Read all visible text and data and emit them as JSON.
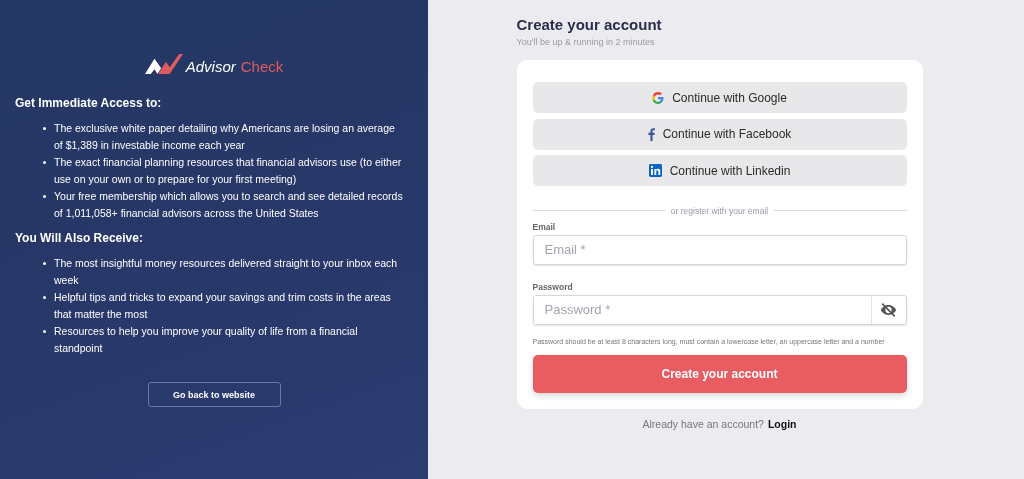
{
  "brand": {
    "name_part_1": "Advisor",
    "name_part_2": "Check"
  },
  "sections": [
    {
      "heading": "Get Immediate Access to:",
      "items": [
        "The exclusive white paper detailing why Americans are losing an average of $1,389 in investable income each year",
        "The exact financial planning resources that financial advisors use (to either use on your own or to prepare for your first meeting)",
        "Your free membership which allows you to search and see detailed records of 1,011,058+ financial advisors across the United States"
      ]
    },
    {
      "heading": "You Will Also Receive:",
      "items": [
        "The most insightful money resources delivered straight to your inbox each week",
        "Helpful tips and tricks to expand your savings and trim costs in the areas that matter the most",
        "Resources to help you improve your quality of life from a financial standpoint"
      ]
    }
  ],
  "back_button": "Go back to website",
  "form": {
    "title": "Create your account",
    "subtitle": "You'll be up & running in 2 minutes",
    "social_buttons": [
      {
        "kind": "google",
        "label": "Continue with Google"
      },
      {
        "kind": "facebook",
        "label": "Continue with Facebook"
      },
      {
        "kind": "linkedin",
        "label": "Continue with Linkedin"
      }
    ],
    "divider": "or register with your email",
    "email": {
      "label": "Email",
      "placeholder": "Email *"
    },
    "password": {
      "label": "Password",
      "placeholder": "Password *",
      "hint": "Password should be at least 8 characters long, must contain a lowercase letter, an uppercase letter and a number"
    },
    "submit": "Create your account"
  },
  "login_prompt": {
    "text": "Already have an account?",
    "link": "Login"
  }
}
